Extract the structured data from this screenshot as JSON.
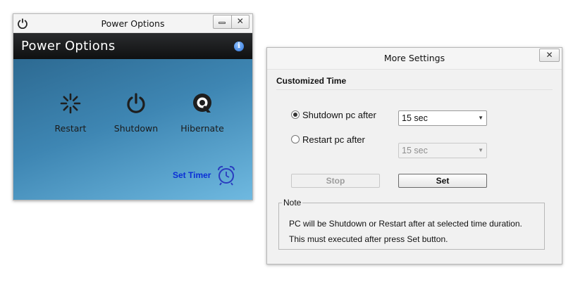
{
  "power_window": {
    "title": "Power Options",
    "header_title": "Power Options",
    "options": [
      {
        "label": "Restart",
        "icon": "restart-icon"
      },
      {
        "label": "Shutdown",
        "icon": "power-icon"
      },
      {
        "label": "Hibernate",
        "icon": "hibernate-icon"
      }
    ],
    "set_timer_label": "Set Timer"
  },
  "settings_window": {
    "title": "More Settings",
    "section_title": "Customized Time",
    "shutdown_option": {
      "label": "Shutdown pc after",
      "checked": true,
      "value": "15 sec"
    },
    "restart_option": {
      "label": "Restart pc after",
      "checked": false,
      "value": "15 sec"
    },
    "buttons": {
      "stop": "Stop",
      "set": "Set"
    },
    "note": {
      "legend": "Note",
      "line1": "PC will be Shutdown or Restart after at selected time duration.",
      "line2": "This must executed after press Set button."
    }
  },
  "colors": {
    "header_band": "#1a1b1c",
    "content_top": "#2d6a92",
    "content_bottom": "#6fb9e0",
    "set_timer_link": "#0b2fd6"
  }
}
